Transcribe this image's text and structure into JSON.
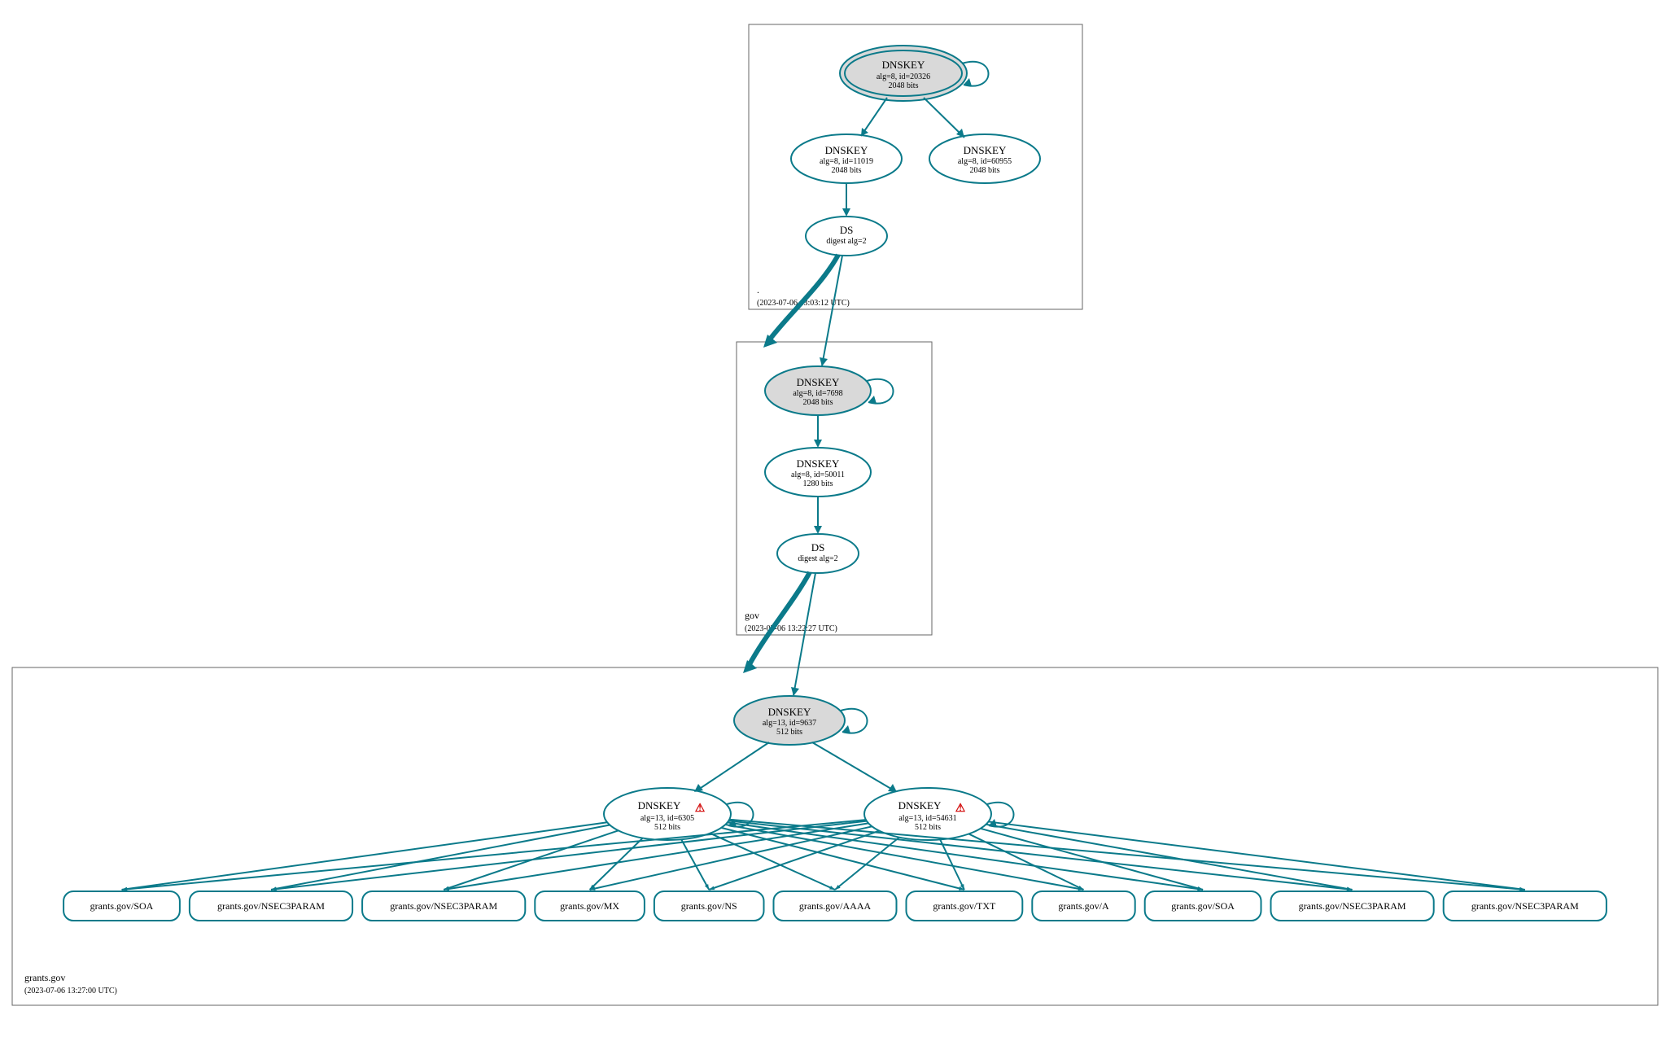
{
  "zones": {
    "root": {
      "label": ".",
      "timestamp": "(2023-07-06 13:03:12 UTC)"
    },
    "gov": {
      "label": "gov",
      "timestamp": "(2023-07-06 13:22:27 UTC)"
    },
    "grants": {
      "label": "grants.gov",
      "timestamp": "(2023-07-06 13:27:00 UTC)"
    }
  },
  "nodes": {
    "root_ksk": {
      "title": "DNSKEY",
      "line2": "alg=8, id=20326",
      "line3": "2048 bits"
    },
    "root_zsk1": {
      "title": "DNSKEY",
      "line2": "alg=8, id=11019",
      "line3": "2048 bits"
    },
    "root_zsk2": {
      "title": "DNSKEY",
      "line2": "alg=8, id=60955",
      "line3": "2048 bits"
    },
    "root_ds": {
      "title": "DS",
      "line2": "digest alg=2"
    },
    "gov_ksk": {
      "title": "DNSKEY",
      "line2": "alg=8, id=7698",
      "line3": "2048 bits"
    },
    "gov_zsk": {
      "title": "DNSKEY",
      "line2": "alg=8, id=50011",
      "line3": "1280 bits"
    },
    "gov_ds": {
      "title": "DS",
      "line2": "digest alg=2"
    },
    "grants_ksk": {
      "title": "DNSKEY",
      "line2": "alg=13, id=9637",
      "line3": "512 bits"
    },
    "grants_zsk1": {
      "title": "DNSKEY",
      "line2": "alg=13, id=6305",
      "line3": "512 bits",
      "warn": true
    },
    "grants_zsk2": {
      "title": "DNSKEY",
      "line2": "alg=13, id=54631",
      "line3": "512 bits",
      "warn": true
    }
  },
  "rrsets": [
    "grants.gov/SOA",
    "grants.gov/NSEC3PARAM",
    "grants.gov/NSEC3PARAM",
    "grants.gov/MX",
    "grants.gov/NS",
    "grants.gov/AAAA",
    "grants.gov/TXT",
    "grants.gov/A",
    "grants.gov/SOA",
    "grants.gov/NSEC3PARAM",
    "grants.gov/NSEC3PARAM"
  ],
  "warning_glyph": "⚠"
}
